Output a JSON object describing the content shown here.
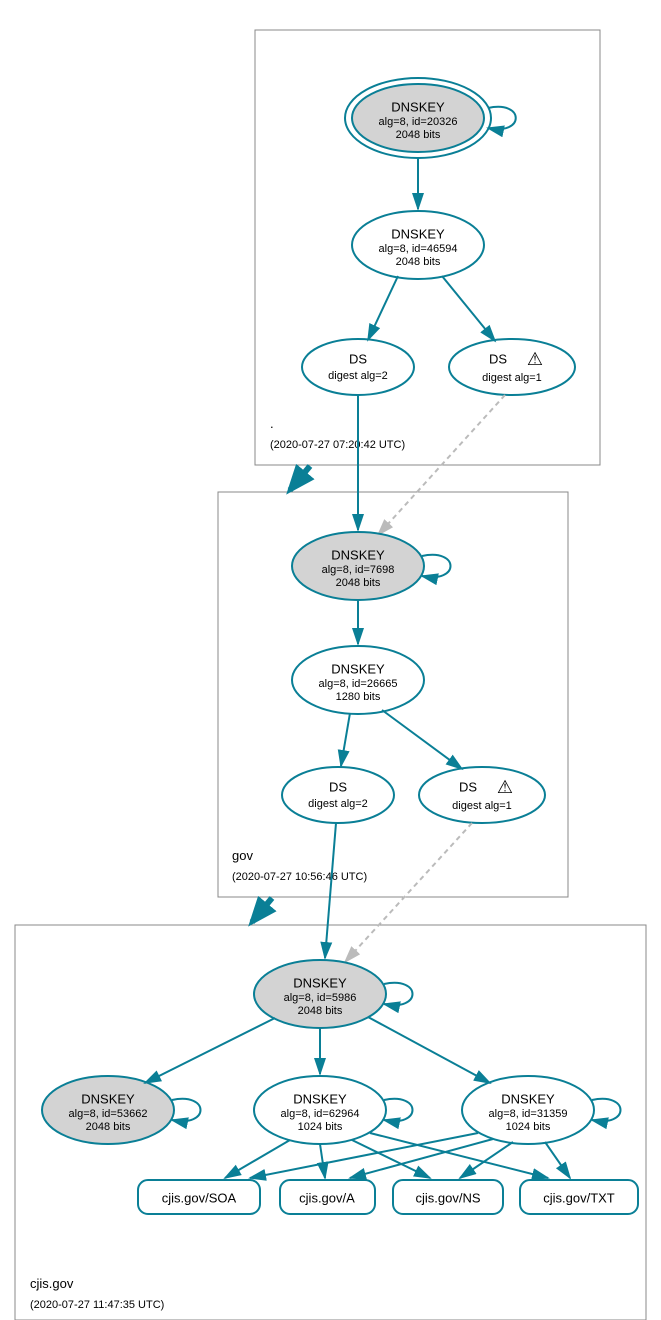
{
  "zones": {
    "root": {
      "name": ".",
      "timestamp": "(2020-07-27 07:20:42 UTC)"
    },
    "gov": {
      "name": "gov",
      "timestamp": "(2020-07-27 10:56:46 UTC)"
    },
    "cjis": {
      "name": "cjis.gov",
      "timestamp": "(2020-07-27 11:47:35 UTC)"
    }
  },
  "nodes": {
    "root_ksk": {
      "title": "DNSKEY",
      "props": "alg=8, id=20326",
      "bits": "2048 bits"
    },
    "root_zsk": {
      "title": "DNSKEY",
      "props": "alg=8, id=46594",
      "bits": "2048 bits"
    },
    "root_ds2": {
      "title": "DS",
      "props": "digest alg=2"
    },
    "root_ds1": {
      "title": "DS",
      "props": "digest alg=1"
    },
    "gov_ksk": {
      "title": "DNSKEY",
      "props": "alg=8, id=7698",
      "bits": "2048 bits"
    },
    "gov_zsk": {
      "title": "DNSKEY",
      "props": "alg=8, id=26665",
      "bits": "1280 bits"
    },
    "gov_ds2": {
      "title": "DS",
      "props": "digest alg=2"
    },
    "gov_ds1": {
      "title": "DS",
      "props": "digest alg=1"
    },
    "cjis_ksk": {
      "title": "DNSKEY",
      "props": "alg=8, id=5986",
      "bits": "2048 bits"
    },
    "cjis_k1": {
      "title": "DNSKEY",
      "props": "alg=8, id=53662",
      "bits": "2048 bits"
    },
    "cjis_k2": {
      "title": "DNSKEY",
      "props": "alg=8, id=62964",
      "bits": "1024 bits"
    },
    "cjis_k3": {
      "title": "DNSKEY",
      "props": "alg=8, id=31359",
      "bits": "1024 bits"
    }
  },
  "records": {
    "soa": "cjis.gov/SOA",
    "a": "cjis.gov/A",
    "ns": "cjis.gov/NS",
    "txt": "cjis.gov/TXT"
  },
  "icons": {
    "warning": "⚠"
  }
}
